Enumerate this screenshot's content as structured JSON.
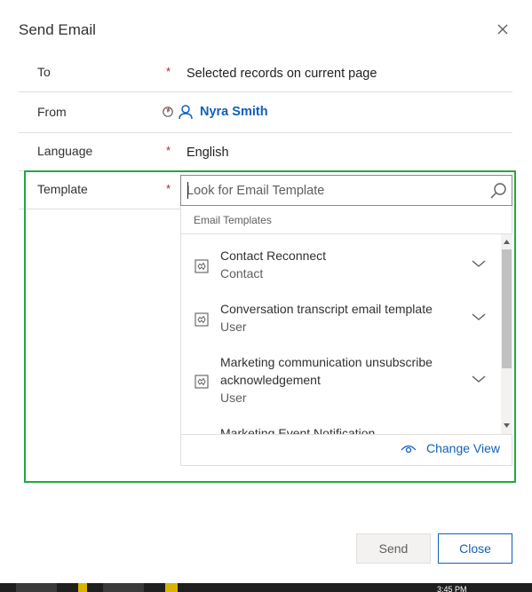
{
  "dialog": {
    "title": "Send Email"
  },
  "fields": {
    "to": {
      "label": "To",
      "required": "*",
      "value": "Selected records on current page"
    },
    "from": {
      "label": "From",
      "required": "*",
      "value": "Nyra Smith"
    },
    "language": {
      "label": "Language",
      "required": "*",
      "value": "English"
    },
    "template": {
      "label": "Template",
      "required": "*"
    }
  },
  "search": {
    "placeholder": "Look for Email Template",
    "value": ""
  },
  "dropdown": {
    "header": "Email Templates",
    "items": [
      {
        "name": "Contact Reconnect",
        "type": "Contact"
      },
      {
        "name": "Conversation transcript email template",
        "type": "User"
      },
      {
        "name": "Marketing communication unsubscribe acknowledgement",
        "type": "User"
      },
      {
        "name": "Marketing Event Notification",
        "type": ""
      }
    ],
    "change_view_label": "Change View"
  },
  "buttons": {
    "send": "Send",
    "close": "Close"
  },
  "taskbar": {
    "clock": "3:45 PM"
  },
  "colors": {
    "accent": "#1160b7",
    "required": "#a4262c",
    "highlight": "#22a843"
  }
}
